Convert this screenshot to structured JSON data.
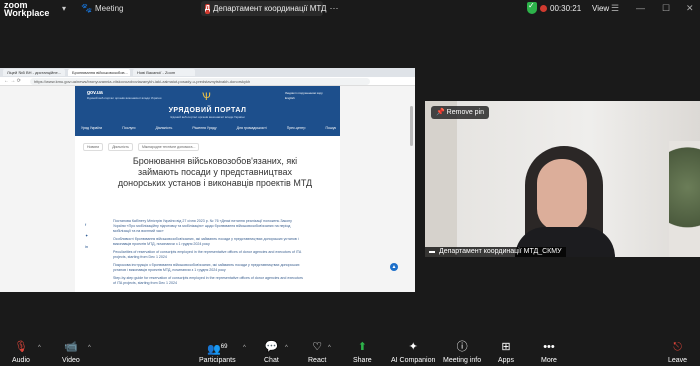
{
  "app": {
    "brand_line1": "zoom",
    "brand_line2": "Workplace",
    "meeting_label": "Meeting"
  },
  "share_pill": {
    "icon_letter": "Д",
    "label": "Департамент координації МТД"
  },
  "status": {
    "timer": "00:30:21",
    "view_label": "View",
    "rec_color": "#d03a2f",
    "secure_color": "#2db34a"
  },
  "browser": {
    "tabs": [
      "Ліцей №5 ВН - дистанційне...",
      "Бронювання військовозобов...",
      "Нові Вакансії - Zoom"
    ],
    "url": "https://www.kmu.gov.ua/news/bronyuvannia-viiskovozoboviazanykh-iaki-zaimaiut-posady-u-predstavnytstvakh-donorskykh"
  },
  "portal": {
    "gov": "gov.ua",
    "gov_sub": "Єдиний веб-портал органів виконавчої влади України",
    "title": "УРЯДОВИЙ ПОРТАЛ",
    "subtitle": "Єдиний веб-портал органів виконавчої влади України",
    "side_links": [
      "Людям із порушенням зору",
      "English"
    ],
    "menu": [
      "Уряд України",
      "Послуги",
      "Діяльність",
      "Рішення Уряду",
      "Для громадськості",
      "Прес-центр",
      "Пошук"
    ],
    "breadcrumbs": [
      "Новини",
      "Діяльність",
      "Міжнародне технічне допомога..."
    ],
    "article_title": "Бронювання військовозобов'язаних, які займають посади у представництвах донорських установ і виконавців проектів МТД",
    "paragraphs": [
      "Постанова Кабінету Міністрів України від 27 січня 2023 р. № 76 «Деякі питання реалізації положень Закону України «Про мобілізаційну підготовку та мобілізацію» щодо бронювання військовозобов'язаних на період мобілізації та на воєнний час»",
      "Особливості бронювання військовозобов'язаних, які займають посади у представництвах донорських установ і виконавців проектів МТД, починаючи з 1 грудня 2024 року",
      "Peculiarities of reservation of conscripts employed in the representative offices of donor agencies and executors of ITA projects, starting from Dec 1 2024",
      "Покрокова інструкція з бронювання військовозобов'язаних, які займають посади у представництвах донорських установ і виконавців проектів МТД, починаючи з 1 грудня 2024 року",
      "Step-by-step guide for reservation of conscripts employed in the representative offices of donor agencies and executors of ITA projects, starting from Dec 1 2024"
    ]
  },
  "video": {
    "pin_label": "Remove pin",
    "name": "Департамент координації МТД_СКМУ"
  },
  "toolbar": {
    "audio": "Audio",
    "video": "Video",
    "participants": "Participants",
    "participants_count": "69",
    "chat": "Chat",
    "react": "React",
    "share": "Share",
    "ai": "AI Companion",
    "meeting_info": "Meeting info",
    "apps": "Apps",
    "more": "More",
    "leave": "Leave"
  }
}
